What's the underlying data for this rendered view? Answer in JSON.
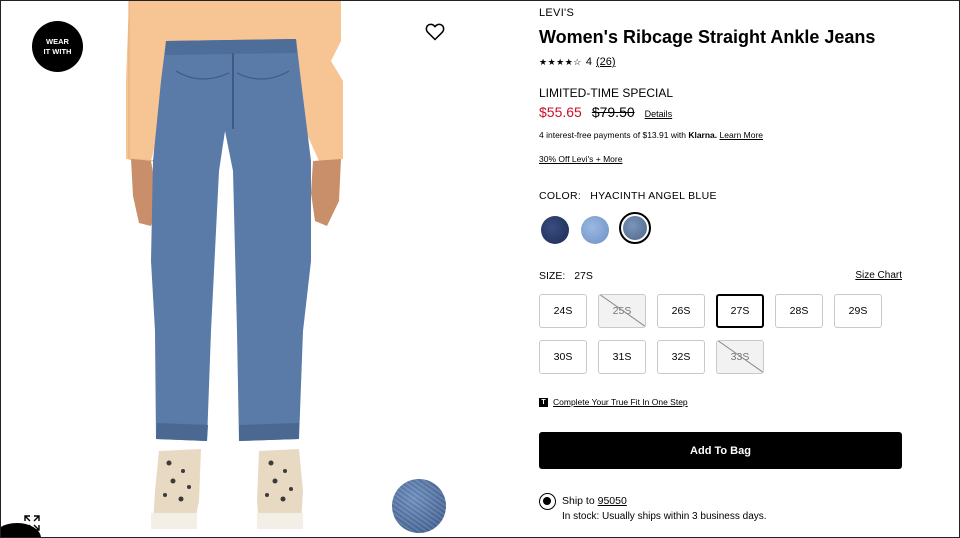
{
  "media": {
    "badge_line1": "WEAR",
    "badge_line2": "IT WITH",
    "heart_icon": "heart-outline-icon",
    "expand_icon": "expand-icon"
  },
  "product": {
    "brand": "LEVI'S",
    "title": "Women's Ribcage Straight Ankle Jeans",
    "rating_value": 4,
    "rating_text": "4",
    "review_count": "(26)",
    "promo_label": "LIMITED-TIME SPECIAL",
    "sale_price": "$55.65",
    "original_price": "$79.50",
    "details_link": "Details",
    "klarna_prefix": "4 interest-free payments of $13.91 with",
    "klarna_brand": "Klarna.",
    "klarna_link": "Learn More",
    "offer_link": "30% Off Levi's + More"
  },
  "color": {
    "label": "COLOR:",
    "selected": "HYACINTH ANGEL BLUE",
    "swatches": [
      "#1c2a55",
      "#7a9ccf",
      "#5a7396"
    ]
  },
  "size": {
    "label": "SIZE:",
    "selected": "27S",
    "size_chart": "Size Chart",
    "options": [
      "24S",
      "25S",
      "26S",
      "27S",
      "28S",
      "29S",
      "30S",
      "31S",
      "32S",
      "33S"
    ]
  },
  "truefit": {
    "icon_letter": "T",
    "link": "Complete Your True Fit In One Step"
  },
  "cart": {
    "add_label": "Add To Bag"
  },
  "shipping": {
    "prefix": "Ship to",
    "zip": "95050",
    "stock": "In stock: Usually ships within 3 business days."
  }
}
